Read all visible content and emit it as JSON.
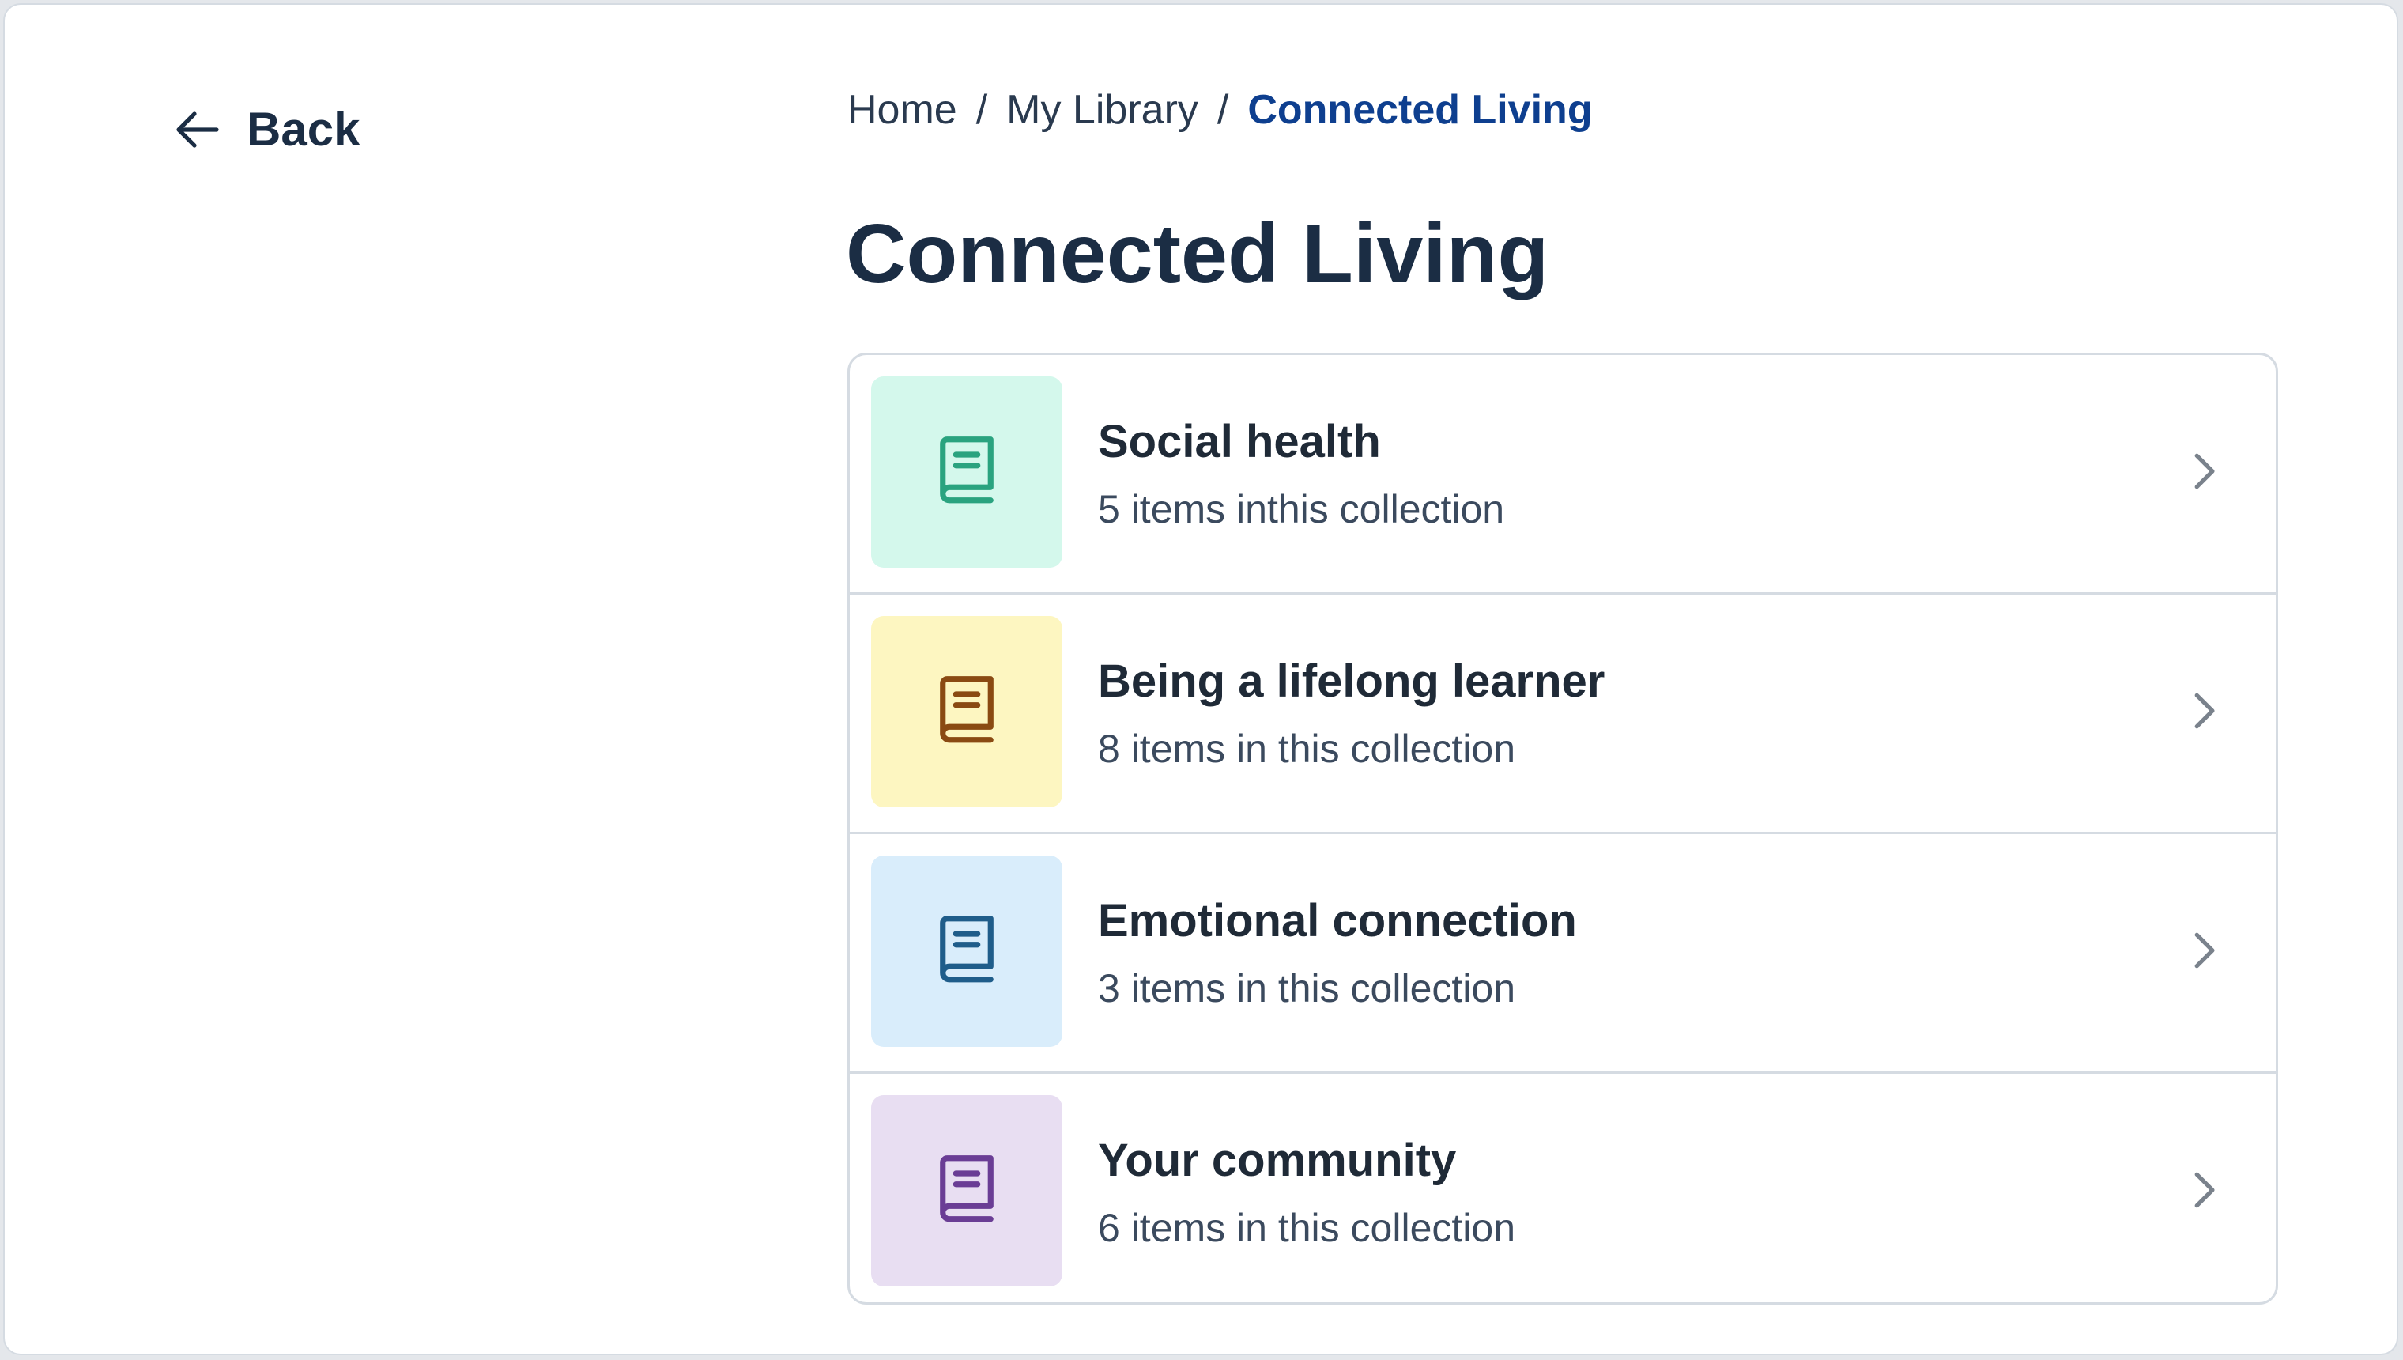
{
  "nav": {
    "back_label": "Back",
    "back_icon": "arrow-left-icon"
  },
  "breadcrumb": {
    "items": [
      "Home",
      "My Library"
    ],
    "current": "Connected Living",
    "separator": "/"
  },
  "page_title": "Connected Living",
  "collections": [
    {
      "title": "Social health",
      "subtitle": "5 items inthis collection",
      "icon": "book-icon",
      "tile_bg": "#d4f8ec",
      "icon_color": "#2aa37f"
    },
    {
      "title": "Being a lifelong learner",
      "subtitle": "8 items in this collection",
      "icon": "book-icon",
      "tile_bg": "#fdf6c1",
      "icon_color": "#8a4a12"
    },
    {
      "title": "Emotional connection",
      "subtitle": "3 items in this collection",
      "icon": "book-icon",
      "tile_bg": "#d9edfb",
      "icon_color": "#1f5d8a"
    },
    {
      "title": "Your community",
      "subtitle": "6 items in this collection",
      "icon": "book-icon",
      "tile_bg": "#e8def2",
      "icon_color": "#6a3d95"
    }
  ],
  "colors": {
    "text_primary": "#1b2d44",
    "breadcrumb_current": "#0e3f8f",
    "border": "#d5dbe2",
    "chevron": "#7a828c"
  }
}
